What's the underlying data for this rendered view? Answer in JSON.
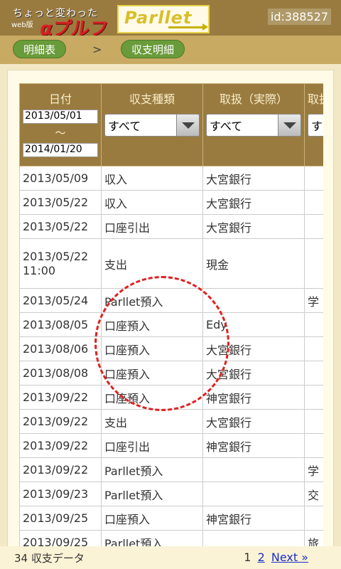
{
  "header": {
    "tagline_line1": "ちょっと変わった",
    "tagline_line2": "web版",
    "brand_big": "αプルファ版",
    "logo_text": "Parllet",
    "user_id": "id:388527"
  },
  "breadcrumb": {
    "items": [
      "明細表",
      "収支明細"
    ],
    "separator": ">"
  },
  "table": {
    "headers": {
      "date": "日付",
      "type": "収支種類",
      "handler": "取扱（実際）",
      "handler2": "取扱"
    },
    "filters": {
      "date_from": "2013/05/01",
      "range_sep": "〜",
      "date_to": "2014/01/20",
      "type_select": "すべて",
      "handler_select": "すべて",
      "handler2_select": "す"
    },
    "rows": [
      {
        "date": "2013/05/09",
        "type": "収入",
        "handler": "大宮銀行",
        "extra": ""
      },
      {
        "date": "2013/05/22",
        "type": "収入",
        "handler": "大宮銀行",
        "extra": ""
      },
      {
        "date": "2013/05/22",
        "type": "口座引出",
        "handler": "大宮銀行",
        "extra": ""
      },
      {
        "date": "2013/05/22 11:00",
        "type": "支出",
        "handler": "現金",
        "extra": ""
      },
      {
        "date": "2013/05/24",
        "type": "Parllet預入",
        "handler": "",
        "extra": "学"
      },
      {
        "date": "2013/08/05",
        "type": "口座預入",
        "handler": "Edy",
        "extra": ""
      },
      {
        "date": "2013/08/06",
        "type": "口座預入",
        "handler": "大宮銀行",
        "extra": ""
      },
      {
        "date": "2013/08/08",
        "type": "口座預入",
        "handler": "大宮銀行",
        "extra": ""
      },
      {
        "date": "2013/09/22",
        "type": "口座預入",
        "handler": "神宮銀行",
        "extra": ""
      },
      {
        "date": "2013/09/22",
        "type": "支出",
        "handler": "大宮銀行",
        "extra": ""
      },
      {
        "date": "2013/09/22",
        "type": "口座引出",
        "handler": "神宮銀行",
        "extra": ""
      },
      {
        "date": "2013/09/22",
        "type": "Parllet預入",
        "handler": "",
        "extra": "学"
      },
      {
        "date": "2013/09/23",
        "type": "Parllet預入",
        "handler": "",
        "extra": "交"
      },
      {
        "date": "2013/09/25",
        "type": "口座預入",
        "handler": "神宮銀行",
        "extra": ""
      },
      {
        "date": "2013/09/25",
        "type": "Parllet預入",
        "handler": "",
        "extra": "旅"
      }
    ]
  },
  "footer": {
    "count_text": "34 収支データ",
    "page_current": "1",
    "page_2": "2",
    "next": "Next »"
  },
  "colors": {
    "header_bg": "#9a7b3f",
    "breadcrumb_bg": "#c8aa63",
    "crumb_green": "#6a9b3a",
    "annotation_red": "#e02020",
    "link_blue": "#1a2fc9"
  }
}
